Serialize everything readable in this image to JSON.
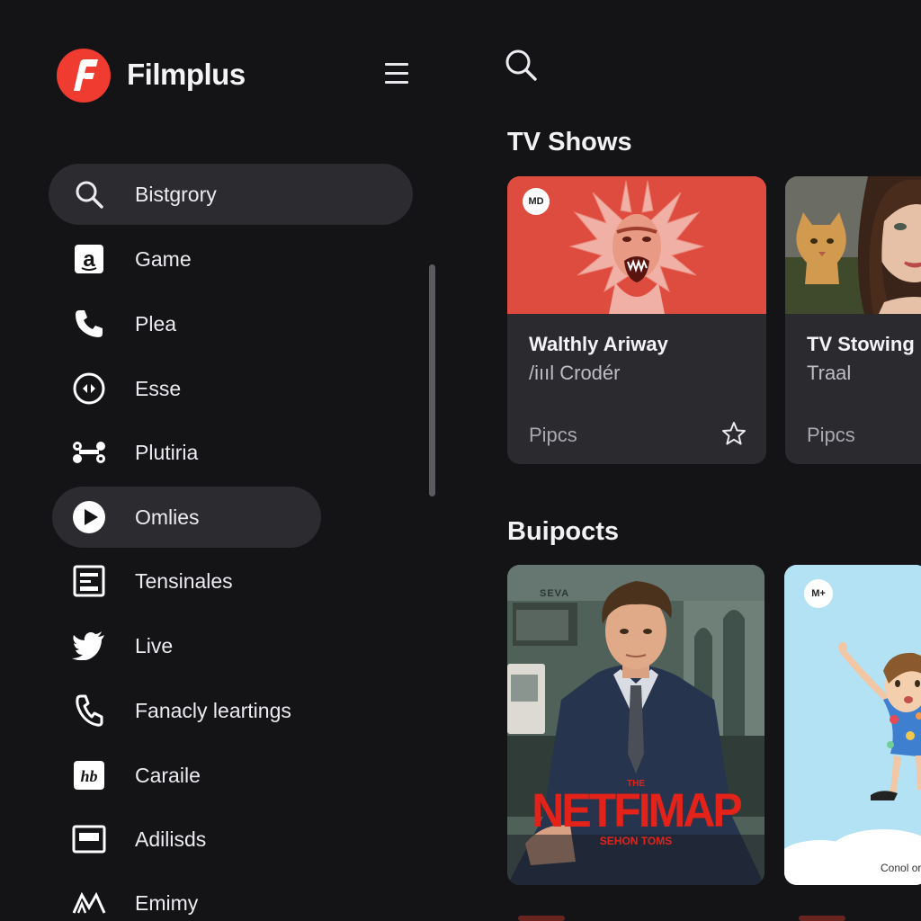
{
  "app": {
    "name": "Filmplus",
    "logo_letter": "F"
  },
  "colors": {
    "accent": "#ef3b30",
    "background": "#141417",
    "card": "#2a2a2f",
    "active_item": "#2b2b30"
  },
  "sidebar": {
    "items": [
      {
        "label": "Bistgrory",
        "icon": "search-icon",
        "active": true
      },
      {
        "label": "Game",
        "icon": "amazon-a-icon",
        "active": false
      },
      {
        "label": "Plea",
        "icon": "phone-icon",
        "active": false
      },
      {
        "label": "Esse",
        "icon": "circle-arrows-icon",
        "active": false
      },
      {
        "label": "Plutiria",
        "icon": "bone-icon",
        "active": false
      },
      {
        "label": "Omlies",
        "icon": "play-circle-icon",
        "active": true
      },
      {
        "label": "Tensinales",
        "icon": "document-icon",
        "active": false
      },
      {
        "label": "Live",
        "icon": "bird-icon",
        "active": false
      },
      {
        "label": "Fanacly leartings",
        "icon": "phone-icon",
        "active": false
      },
      {
        "label": "Caraile",
        "icon": "hbo-icon",
        "active": false
      },
      {
        "label": "Adilisds",
        "icon": "tv-icon",
        "active": false
      },
      {
        "label": "Emimy",
        "icon": "mountain-icon",
        "active": false
      }
    ]
  },
  "main": {
    "search_icon": "search-icon",
    "sections": [
      {
        "title": "TV Shows",
        "cards": [
          {
            "title": "Walthly Ariway",
            "subtitle": "/iııl Crodér",
            "footer": "Pipcs",
            "badge": "MD",
            "favorite_icon": "star-icon"
          },
          {
            "title": "TV Stowing",
            "subtitle": "Traal",
            "footer": "Pipcs"
          }
        ]
      },
      {
        "title": "Buipocts",
        "cards": [
          {
            "poster_kicker": "THE",
            "poster_title": "NETFIMAP",
            "poster_sub": "SEHON TOMS",
            "sign_text": "SEVA"
          },
          {
            "badge": "M+",
            "caption": "Conol or"
          }
        ]
      }
    ]
  }
}
